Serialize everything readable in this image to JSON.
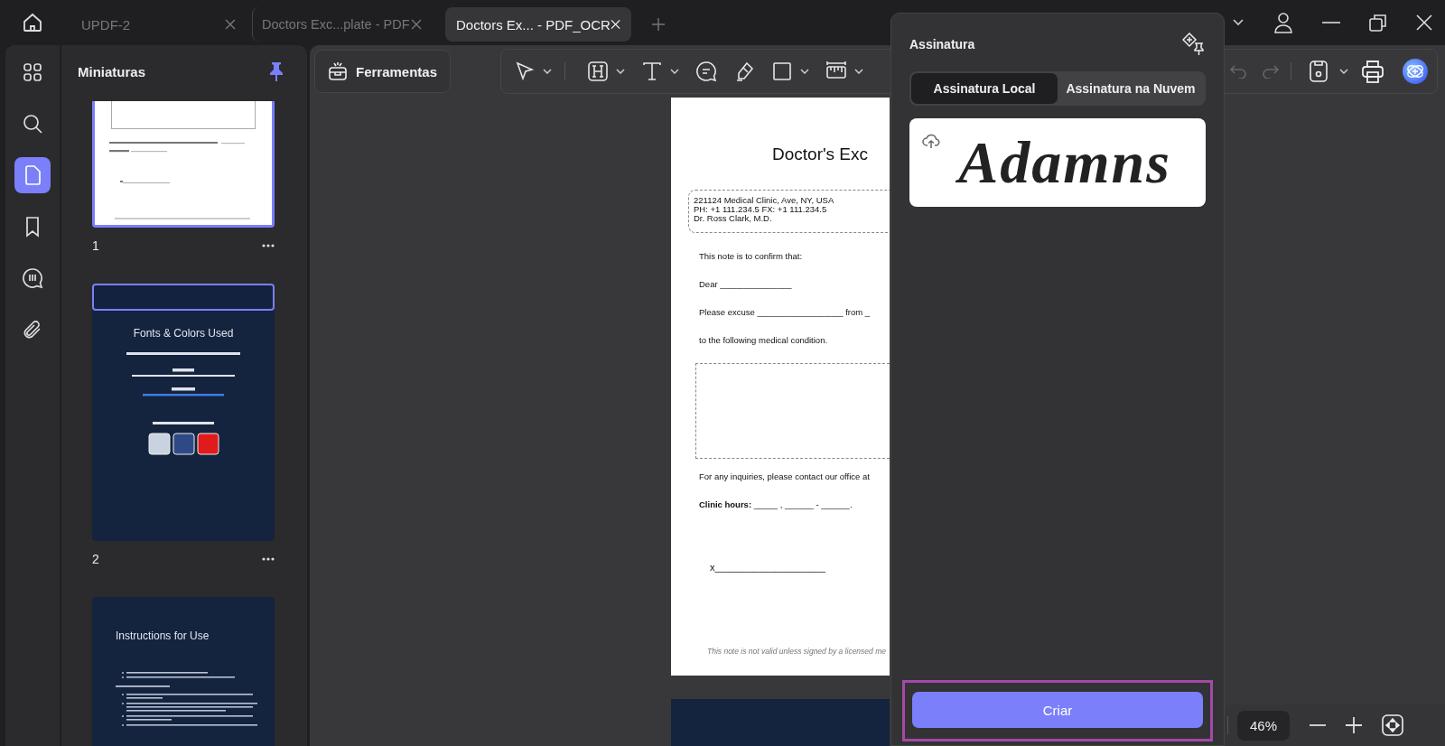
{
  "tabs": [
    {
      "label": "UPDF-2",
      "selected": false
    },
    {
      "label": "Doctors Exc...plate - PDF",
      "selected": false
    },
    {
      "label": "Doctors Ex... - PDF_OCR",
      "selected": true
    }
  ],
  "rail": [
    {
      "kind": "grid",
      "selected": false
    },
    {
      "kind": "search",
      "selected": false
    },
    {
      "kind": "page",
      "selected": true
    },
    {
      "kind": "bookmark",
      "selected": false
    },
    {
      "kind": "comment",
      "selected": false
    },
    {
      "kind": "attachment",
      "selected": false
    }
  ],
  "thumbnails": {
    "title": "Miniaturas",
    "pinned": true,
    "pages": [
      {
        "kind": "excuse",
        "number": "1",
        "selected": true
      },
      {
        "kind": "fonts",
        "number": "2",
        "selected": false,
        "title": "Fonts & Colors Used"
      },
      {
        "kind": "instructions",
        "title": "Instructions for Use"
      }
    ]
  },
  "toolbar": {
    "tools_button": "Ferramentas",
    "tools": [
      {
        "kind": "select",
        "menu": true
      },
      {
        "kind": "highlight",
        "menu": true
      },
      {
        "kind": "text",
        "menu": true
      },
      {
        "kind": "comment",
        "menu": false
      },
      {
        "kind": "pen",
        "menu": false
      },
      {
        "kind": "shape",
        "menu": true
      },
      {
        "kind": "measure",
        "menu": true
      }
    ]
  },
  "document": {
    "title": "Doctor's Exc",
    "address": [
      "221124 Medical Clinic, Ave, NY, USA",
      "PH: +1 111.234.5 FX: +1 111.234.5",
      "Dr. Ross Clark, M.D."
    ],
    "lines": [
      "This note is to confirm that:",
      "Dear _______________",
      "Please excuse __________________   from _",
      "to the following medical condition."
    ],
    "contact": "For any inquiries, please contact our office at",
    "hours": "**Clinic hours:** _____  , ______ - ______.",
    "signature_line": "x____________________",
    "footer": "This note is not valid unless signed by a licensed me"
  },
  "signature_panel": {
    "title": "Assinatura",
    "tabs": [
      {
        "label": "Assinatura Local",
        "selected": true
      },
      {
        "label": "Assinatura na Nuvem",
        "selected": false
      }
    ],
    "signatures": [
      {
        "text": "Adamns",
        "synced": true
      }
    ],
    "create_button": "Criar",
    "highlighted": true
  },
  "zoom": {
    "value": "46%"
  }
}
